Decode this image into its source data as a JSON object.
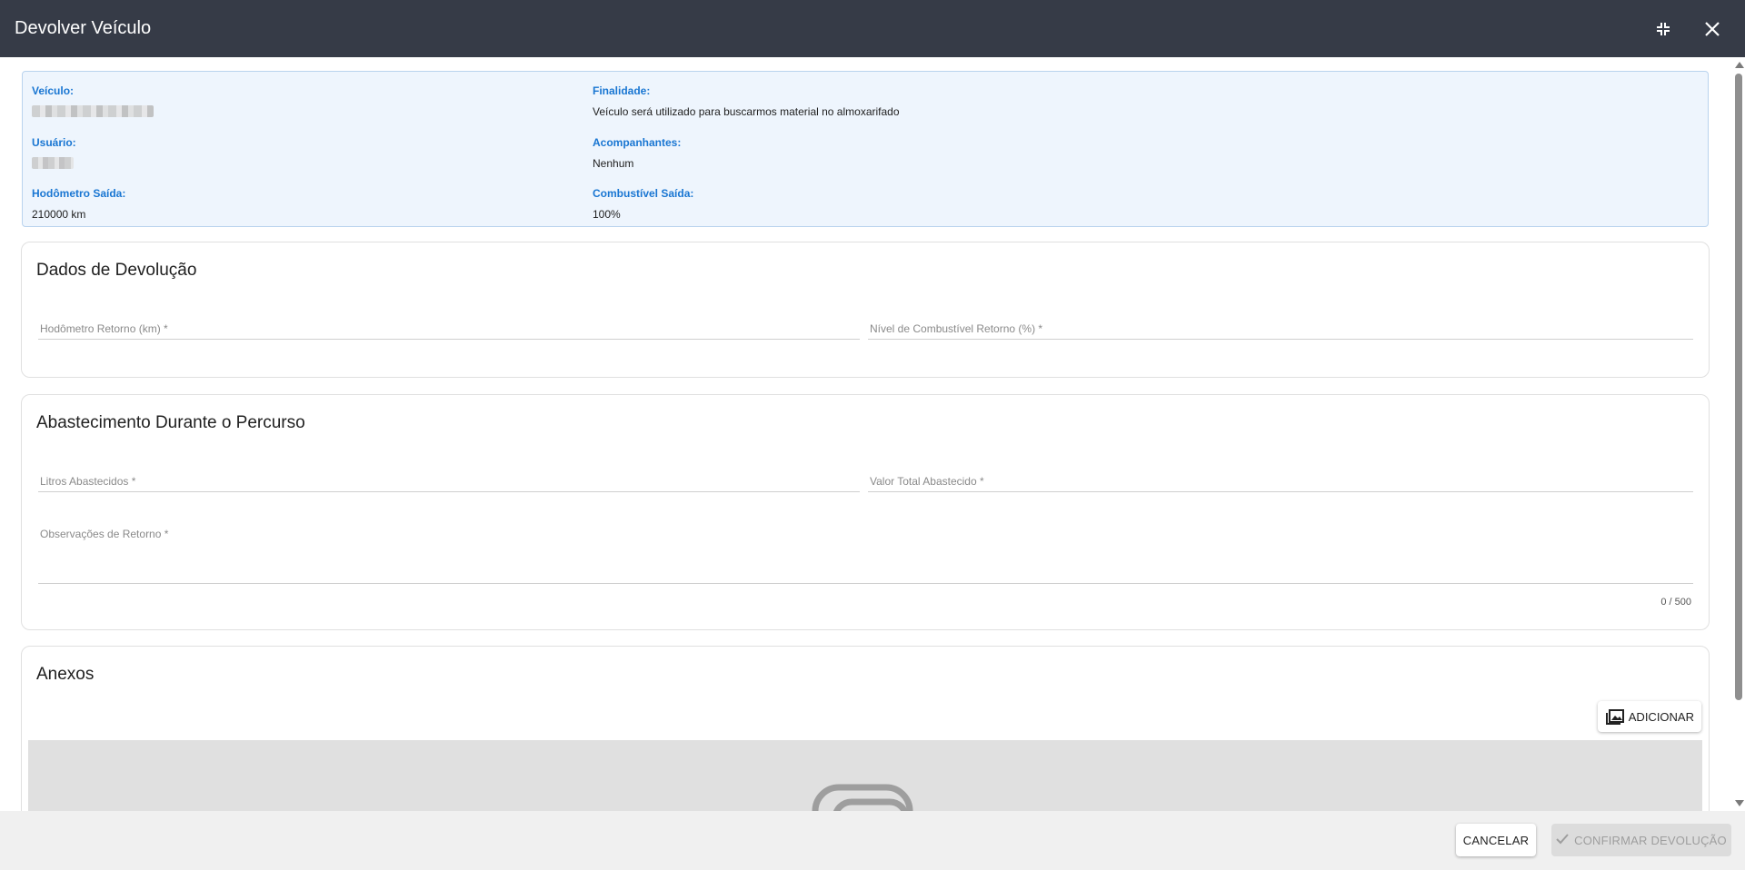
{
  "dialog": {
    "title": "Devolver Veículo",
    "minimize_icon": "minimize-icon",
    "close_icon": "close-icon"
  },
  "info": {
    "veiculo_label": "Veículo:",
    "finalidade_label": "Finalidade:",
    "finalidade_value": "Veículo será utilizado para buscarmos material no almoxarifado",
    "usuario_label": "Usuário:",
    "acompanhantes_label": "Acompanhantes:",
    "acompanhantes_value": "Nenhum",
    "hodometro_saida_label": "Hodômetro Saída:",
    "hodometro_saida_value": "210000 km",
    "combustivel_saida_label": "Combustível Saída:",
    "combustivel_saida_value": "100%"
  },
  "devolucao": {
    "heading": "Dados de Devolução",
    "hodometro_placeholder": "Hodômetro Retorno (km) *",
    "combustivel_placeholder": "Nível de Combustível Retorno (%) *"
  },
  "abastecimento": {
    "heading": "Abastecimento Durante o Percurso",
    "litros_placeholder": "Litros Abastecidos *",
    "valor_placeholder": "Valor Total Abastecido *",
    "observacoes_placeholder": "Observações de Retorno *",
    "counter": "0 / 500"
  },
  "anexos": {
    "heading": "Anexos",
    "add_label": "ADICIONAR",
    "add_icon": "add-photo-icon",
    "placeholder_icon": "attachment-icon"
  },
  "footer": {
    "cancel_label": "CANCELAR",
    "confirm_label": "CONFIRMAR DEVOLUÇÃO",
    "confirm_icon": "check-icon"
  }
}
